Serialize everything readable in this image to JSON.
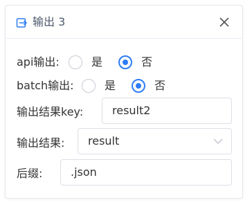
{
  "panel": {
    "title": "输出 3",
    "icon": "output-icon",
    "accent_color": "#2e7cf6",
    "close_icon": "close-icon"
  },
  "form": {
    "api_output": {
      "label": "api输出:",
      "options": [
        "是",
        "否"
      ],
      "selected": "否"
    },
    "batch_output": {
      "label": "batch输出:",
      "options": [
        "是",
        "否"
      ],
      "selected": "否"
    },
    "result_key": {
      "label": "输出结果key:",
      "value": "result2"
    },
    "result": {
      "label": "输出结果:",
      "value": "result",
      "icon": "chevron-down-icon"
    },
    "suffix": {
      "label": "后缀:",
      "value": ".json"
    }
  }
}
